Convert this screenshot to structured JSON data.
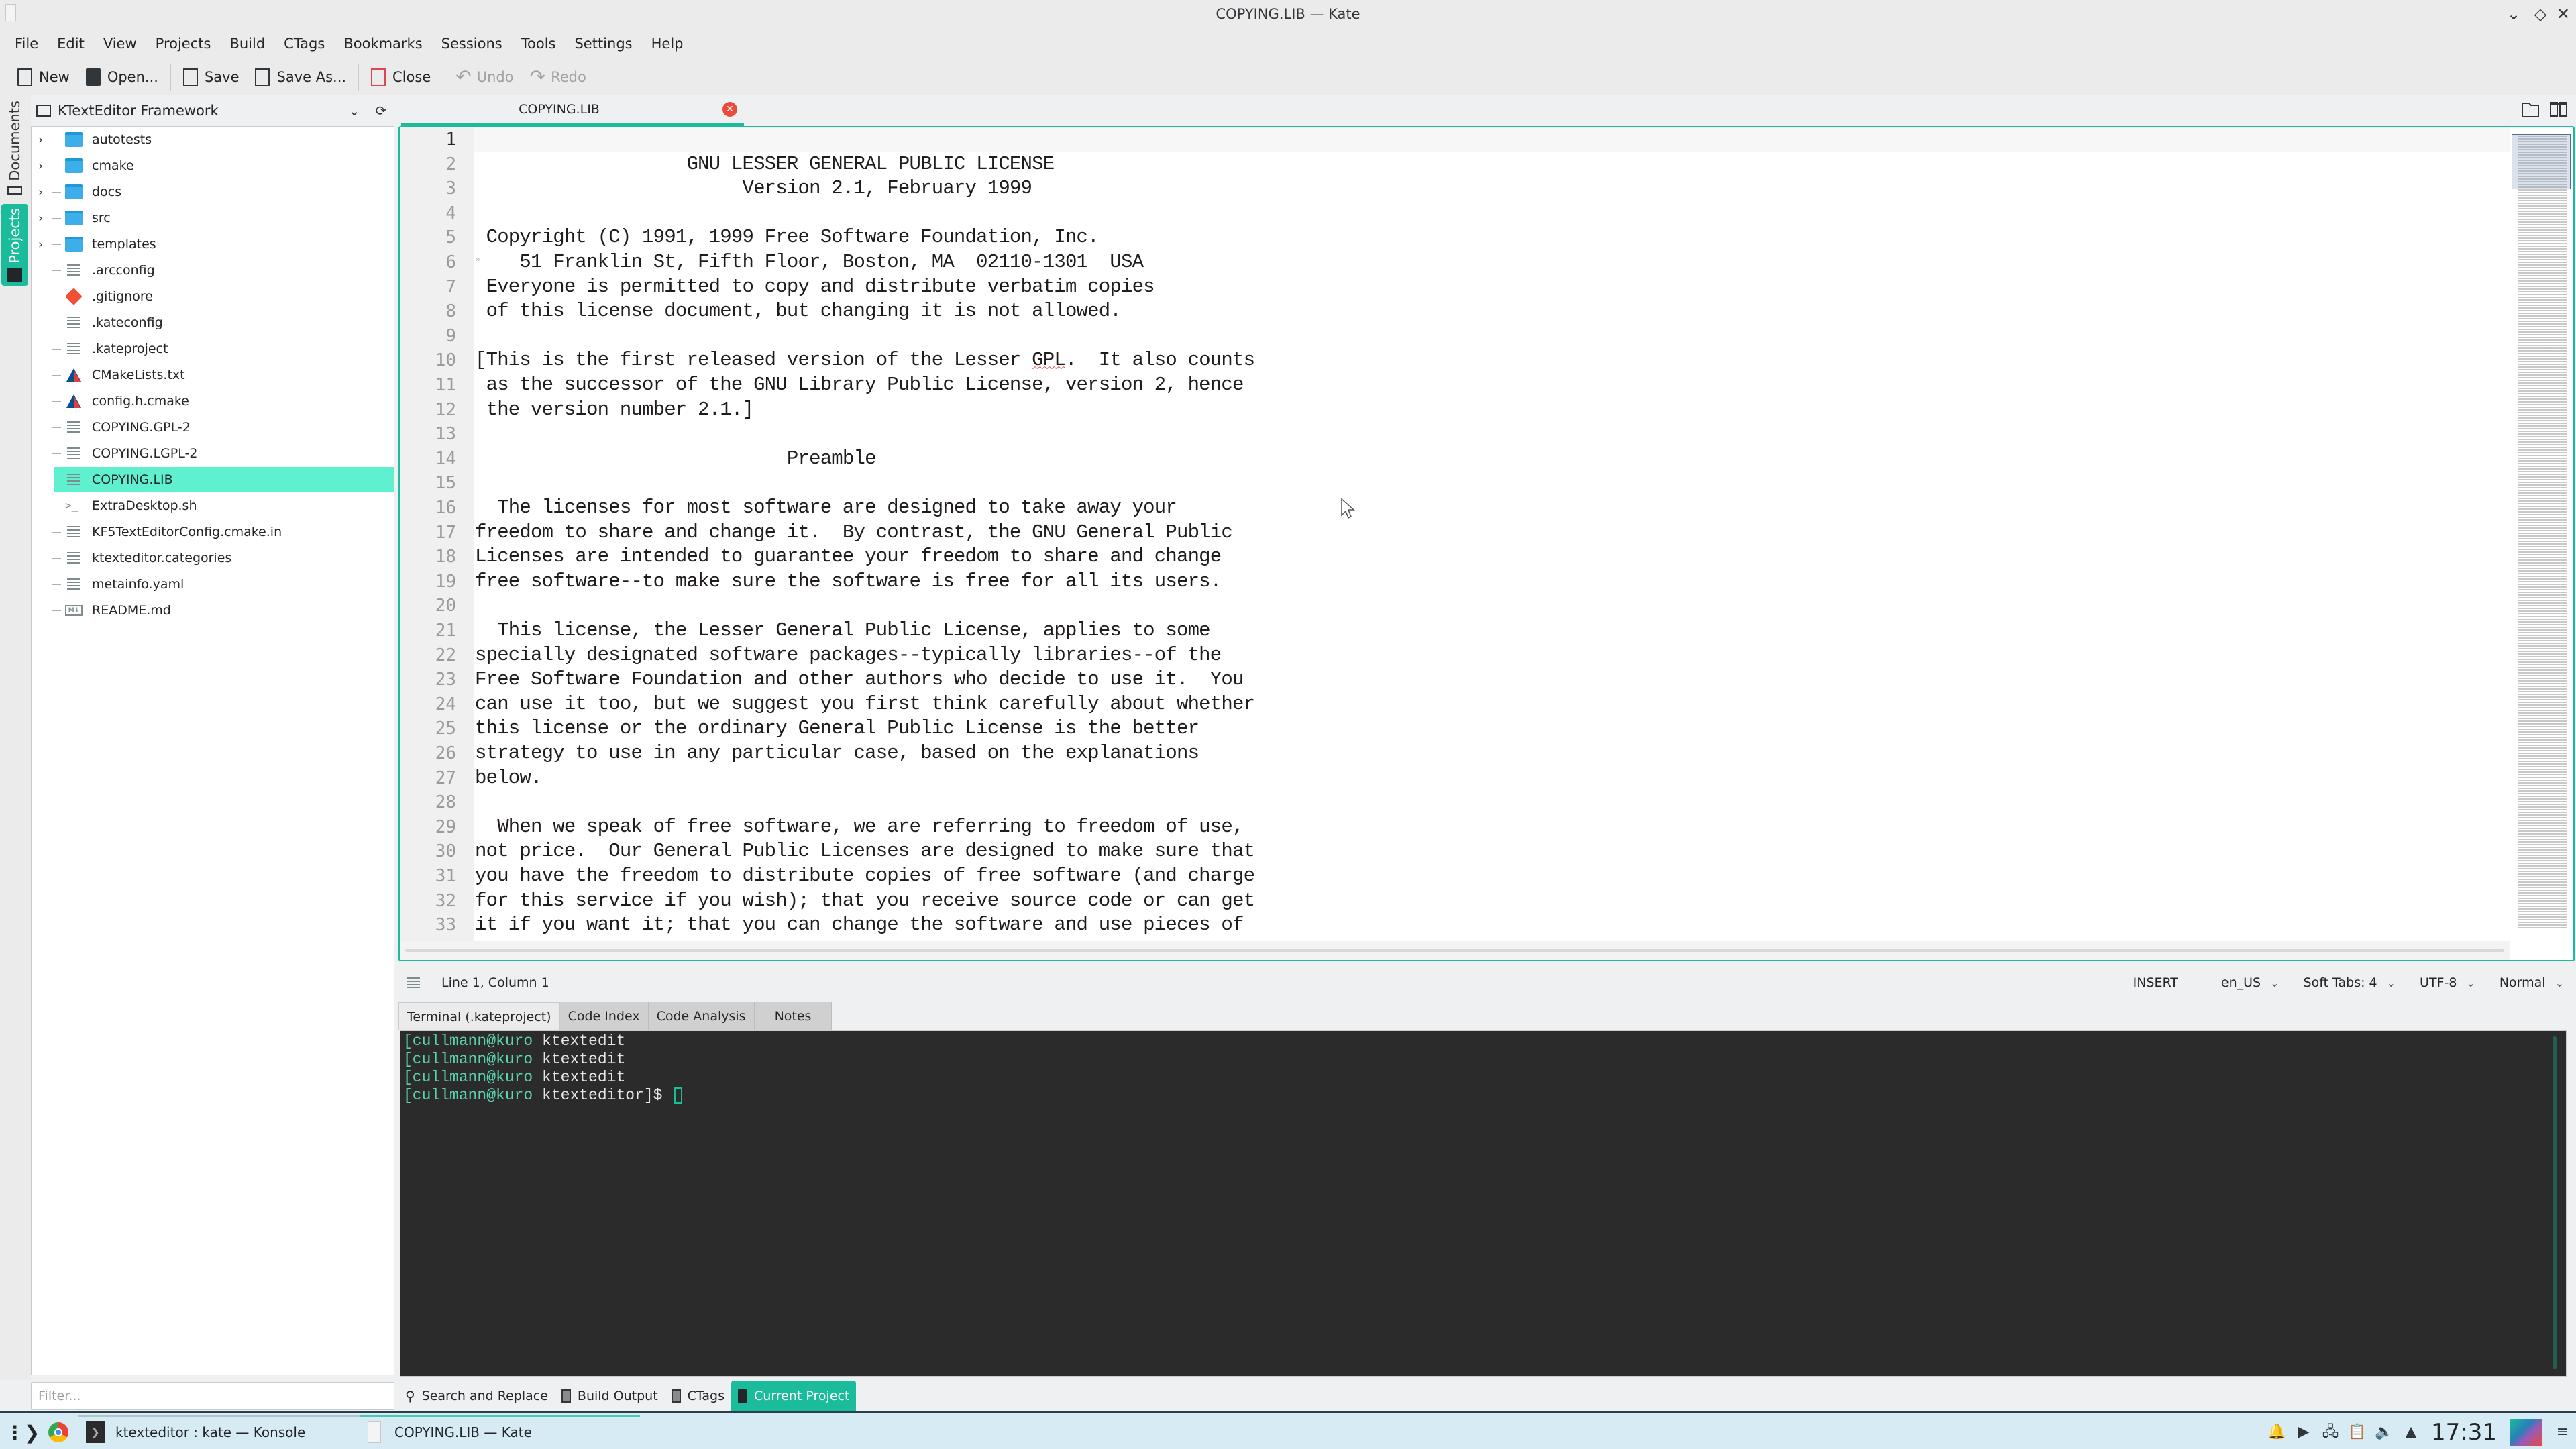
{
  "window": {
    "title": "COPYING.LIB — Kate",
    "controls": [
      "minimize",
      "maximize",
      "close"
    ]
  },
  "menubar": {
    "items": [
      "File",
      "Edit",
      "View",
      "Projects",
      "Build",
      "CTags",
      "Bookmarks",
      "Sessions",
      "Tools",
      "Settings",
      "Help"
    ]
  },
  "toolbar": {
    "new": "New",
    "open": "Open...",
    "save": "Save",
    "save_as": "Save As...",
    "close": "Close",
    "undo": "Undo",
    "redo": "Redo"
  },
  "left_tabs": {
    "documents": "Documents",
    "projects": "Projects"
  },
  "project": {
    "name": "KTextEditor Framework",
    "tree": [
      {
        "name": "autotests",
        "type": "folder",
        "expandable": true
      },
      {
        "name": "cmake",
        "type": "folder",
        "expandable": true
      },
      {
        "name": "docs",
        "type": "folder",
        "expandable": true
      },
      {
        "name": "src",
        "type": "folder",
        "expandable": true
      },
      {
        "name": "templates",
        "type": "folder",
        "expandable": true
      },
      {
        "name": ".arcconfig",
        "type": "text"
      },
      {
        "name": ".gitignore",
        "type": "git"
      },
      {
        "name": ".kateconfig",
        "type": "text"
      },
      {
        "name": ".kateproject",
        "type": "text"
      },
      {
        "name": "CMakeLists.txt",
        "type": "cmake"
      },
      {
        "name": "config.h.cmake",
        "type": "cmake"
      },
      {
        "name": "COPYING.GPL-2",
        "type": "text"
      },
      {
        "name": "COPYING.LGPL-2",
        "type": "text"
      },
      {
        "name": "COPYING.LIB",
        "type": "text",
        "selected": true
      },
      {
        "name": "ExtraDesktop.sh",
        "type": "shell"
      },
      {
        "name": "KF5TextEditorConfig.cmake.in",
        "type": "text"
      },
      {
        "name": "ktexteditor.categories",
        "type": "text"
      },
      {
        "name": "metainfo.yaml",
        "type": "text"
      },
      {
        "name": "README.md",
        "type": "markdown"
      }
    ],
    "filter_placeholder": "Filter..."
  },
  "doc_tabs": [
    {
      "label": "COPYING.LIB",
      "active": true
    }
  ],
  "editor": {
    "current_line": 1,
    "lines": [
      "",
      "                   GNU LESSER GENERAL PUBLIC LICENSE",
      "                        Version 2.1, February 1999",
      "",
      " Copyright (C) 1991, 1999 Free Software Foundation, Inc.",
      "    51 Franklin St, Fifth Floor, Boston, MA  02110-1301  USA",
      " Everyone is permitted to copy and distribute verbatim copies",
      " of this license document, but changing it is not allowed.",
      "",
      "[This is the first released version of the Lesser GPL.  It also counts",
      " as the successor of the GNU Library Public License, version 2, hence",
      " the version number 2.1.]",
      "",
      "                            Preamble",
      "",
      "  The licenses for most software are designed to take away your",
      "freedom to share and change it.  By contrast, the GNU General Public",
      "Licenses are intended to guarantee your freedom to share and change",
      "free software--to make sure the software is free for all its users.",
      "",
      "  This license, the Lesser General Public License, applies to some",
      "specially designated software packages--typically libraries--of the",
      "Free Software Foundation and other authors who decide to use it.  You",
      "can use it too, but we suggest you first think carefully about whether",
      "this license or the ordinary General Public License is the better",
      "strategy to use in any particular case, based on the explanations",
      "below.",
      "",
      "  When we speak of free software, we are referring to freedom of use,",
      "not price.  Our General Public Licenses are designed to make sure that",
      "you have the freedom to distribute copies of free software (and charge",
      "for this service if you wish); that you receive source code or can get",
      "it if you want it; that you can change the software and use pieces of",
      "it in new free programs; and that you are informed that you can do"
    ]
  },
  "statusbar": {
    "position": "Line 1, Column 1",
    "mode": "INSERT",
    "language": "en_US",
    "indent": "Soft Tabs: 4",
    "encoding": "UTF-8",
    "input_mode": "Normal"
  },
  "panel_tabs": [
    "Terminal (.kateproject)",
    "Code Index",
    "Code Analysis",
    "Notes"
  ],
  "terminal": {
    "lines": [
      {
        "prompt": "[cullmann@kuro ",
        "cwd": "ktextedit",
        "suffix": ""
      },
      {
        "prompt": "[cullmann@kuro ",
        "cwd": "ktextedit",
        "suffix": ""
      },
      {
        "prompt": "[cullmann@kuro ",
        "cwd": "ktextedit",
        "suffix": ""
      },
      {
        "prompt": "[cullmann@kuro ",
        "cwd": "ktexteditor",
        "suffix": "]$ "
      }
    ]
  },
  "tool_tabs": [
    {
      "label": "Search and Replace",
      "icon": "search-icon"
    },
    {
      "label": "Build Output",
      "icon": "panel-icon"
    },
    {
      "label": "CTags",
      "icon": "panel-icon"
    },
    {
      "label": "Current Project",
      "icon": "project-icon",
      "active": true
    }
  ],
  "taskbar": {
    "tasks": [
      {
        "label": "ktexteditor : kate — Konsole"
      },
      {
        "label": "COPYING.LIB — Kate",
        "active": true
      }
    ],
    "clock": "17:31"
  },
  "colors": {
    "accent": "#1abc9c",
    "selection": "#5ff0d0",
    "terminal_bg": "#2b2b2b",
    "close_red": "#e74c3c",
    "taskbar_bg": "#d6ebf4"
  }
}
